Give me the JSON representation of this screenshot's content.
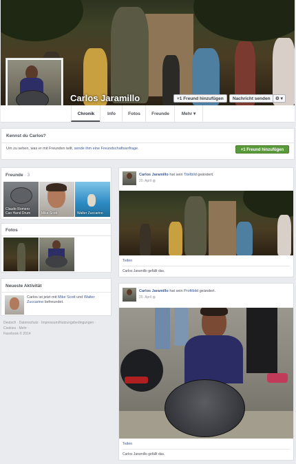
{
  "profile": {
    "name": "Carlos Jaramillo",
    "add_friend": "+1 Freund hinzufügen",
    "send_message": "Nachricht senden",
    "gear": "⚙ ▾"
  },
  "tabs": [
    "Chronik",
    "Info",
    "Fotos",
    "Freunde",
    "Mehr ▾"
  ],
  "know_card": {
    "title": "Kennst du Carlos?",
    "text": "Um zu sehen, was er mit Freunden teilt,",
    "link": "sende ihm eine Freundschaftsanfrage.",
    "button": "+1 Freund hinzufügen"
  },
  "friends": {
    "title": "Freunde",
    "count": "3",
    "items": [
      {
        "name": "Claude Romero\nCao Hand Drum"
      },
      {
        "name": "Mike Scott"
      },
      {
        "name": "Walter Zuccarino"
      }
    ]
  },
  "photos": {
    "title": "Fotos"
  },
  "activity": {
    "title": "Neueste Aktivität",
    "text_pre": "Carlos ist jetzt mit ",
    "friend1": "Mike Scott",
    "and": " und ",
    "friend2": "Walter Zuccarino",
    "text_post": " befreundet."
  },
  "footer": {
    "line1": "Deutsch · Datenschutz · Impressum/Nutzungsbedingungen ·",
    "line2": "Cookies · Mehr ·",
    "line3": "Facebook © 2014"
  },
  "posts": [
    {
      "author": "Carlos Jaramillo",
      "action": " hat sein ",
      "object": "Titelbild",
      "verb": " geändert.",
      "date": "20. April",
      "share": "Teilen",
      "likes": "Carlos Jaramillo gefällt das."
    },
    {
      "author": "Carlos Jaramillo",
      "action": " hat sein ",
      "object": "Profilbild",
      "verb": " geändert.",
      "date": "20. April",
      "share": "Teilen",
      "likes": "Carlos Jaramillo gefällt das."
    }
  ],
  "colors": {
    "link": "#3b5998",
    "green": "#5b9a3a",
    "background": "#e9ebee"
  }
}
